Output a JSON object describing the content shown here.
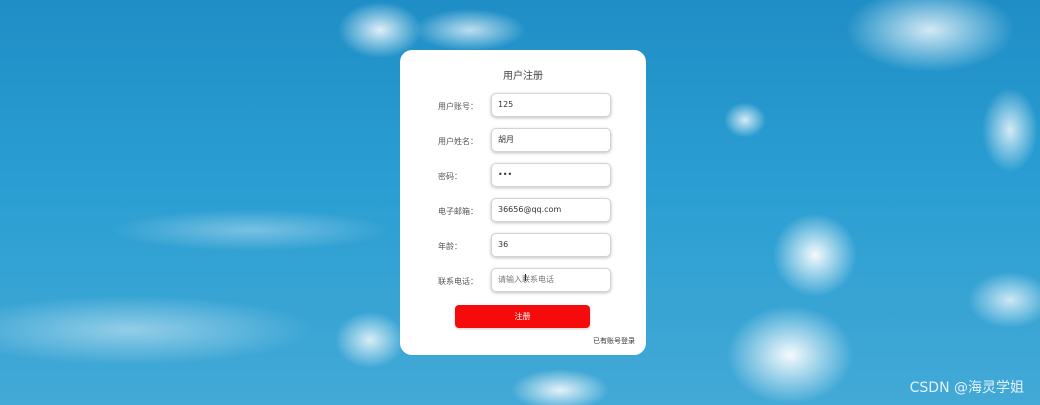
{
  "form": {
    "title": "用户注册",
    "fields": [
      {
        "label": "用户账号：",
        "value": "125",
        "placeholder": ""
      },
      {
        "label": "用户姓名：",
        "value": "胡月",
        "placeholder": ""
      },
      {
        "label": "密码：",
        "value": "•••",
        "placeholder": ""
      },
      {
        "label": "电子邮箱：",
        "value": "36656@qq.com",
        "placeholder": ""
      },
      {
        "label": "年龄：",
        "value": "36",
        "placeholder": ""
      },
      {
        "label": "联系电话：",
        "value": "",
        "placeholder": "请输入联系电话"
      }
    ],
    "submit_label": "注册",
    "login_link": "已有账号登录"
  },
  "watermark": "CSDN @海灵学姐",
  "colors": {
    "submit": "#f50b0b",
    "card": "#ffffff"
  }
}
